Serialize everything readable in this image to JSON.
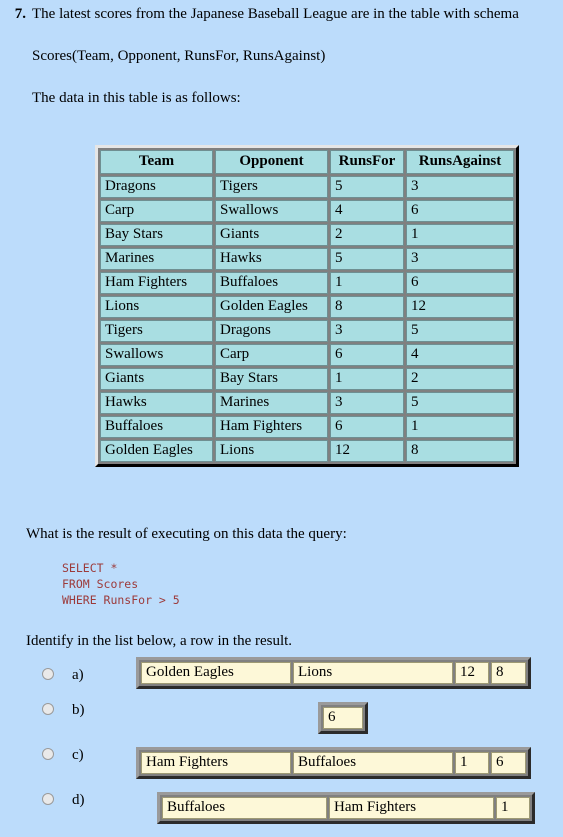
{
  "question": {
    "number": "7.",
    "stem": "The latest scores from the Japanese Baseball League are in the table with schema",
    "schema": "Scores(Team, Opponent, RunsFor, RunsAgainst)",
    "data_intro": "The data in this table is as follows:",
    "query_intro": "What is the result of executing on this data the query:",
    "sql": "SELECT *\nFROM Scores\nWHERE RunsFor > 5",
    "identify": "Identify in the list below, a row in the result."
  },
  "data_table": {
    "headers": [
      "Team",
      "Opponent",
      "RunsFor",
      "RunsAgainst"
    ],
    "rows": [
      [
        "Dragons",
        "Tigers",
        "5",
        "3"
      ],
      [
        "Carp",
        "Swallows",
        "4",
        "6"
      ],
      [
        "Bay Stars",
        "Giants",
        "2",
        "1"
      ],
      [
        "Marines",
        "Hawks",
        "5",
        "3"
      ],
      [
        "Ham Fighters",
        "Buffaloes",
        "1",
        "6"
      ],
      [
        "Lions",
        "Golden Eagles",
        "8",
        "12"
      ],
      [
        "Tigers",
        "Dragons",
        "3",
        "5"
      ],
      [
        "Swallows",
        "Carp",
        "6",
        "4"
      ],
      [
        "Giants",
        "Bay Stars",
        "1",
        "2"
      ],
      [
        "Hawks",
        "Marines",
        "3",
        "5"
      ],
      [
        "Buffaloes",
        "Ham Fighters",
        "6",
        "1"
      ],
      [
        "Golden Eagles",
        "Lions",
        "12",
        "8"
      ]
    ]
  },
  "options": [
    {
      "letter": "a)",
      "cells": [
        "Golden Eagles",
        "Lions",
        "12",
        "8"
      ]
    },
    {
      "letter": "b)",
      "cells": [
        "6"
      ]
    },
    {
      "letter": "c)",
      "cells": [
        "Ham Fighters",
        "Buffaloes",
        "1",
        "6"
      ]
    },
    {
      "letter": "d)",
      "cells": [
        "Buffaloes",
        "Ham Fighters",
        "1"
      ]
    }
  ],
  "colors": {
    "page_background": "#bcdcfb",
    "data_cell": "#a9dee2",
    "answer_cell": "#fdf8d8",
    "sql_text": "#9c3a3a",
    "frame": "#808080"
  }
}
